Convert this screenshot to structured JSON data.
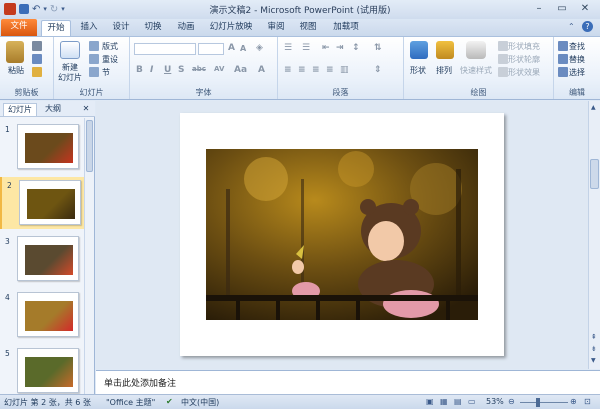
{
  "window": {
    "title": "演示文稿2 - Microsoft PowerPoint (试用版)",
    "controls": [
      "–",
      "▭",
      "✕"
    ]
  },
  "tabs": [
    "文件",
    "开始",
    "插入",
    "设计",
    "切换",
    "动画",
    "幻灯片放映",
    "审阅",
    "视图",
    "加载项"
  ],
  "ribbon": {
    "clipboard": {
      "paste": "粘贴",
      "label": "剪贴板"
    },
    "slides": {
      "new_slide": "新建",
      "new_slide2": "幻灯片",
      "layout": "版式",
      "reset": "重设",
      "section": "节",
      "label": "幻灯片"
    },
    "font": {
      "format_buttons": [
        "B",
        "I",
        "U",
        "S",
        "abc",
        "AV",
        "Aa"
      ],
      "label": "字体"
    },
    "paragraph": {
      "label": "段落"
    },
    "drawing": {
      "shape": "形状",
      "arrange": "排列",
      "quick_styles": "快速样式",
      "shape_fill": "形状填充",
      "shape_outline": "形状轮廓",
      "shape_effects": "形状效果",
      "label": "绘图"
    },
    "editing": {
      "find": "查找",
      "replace": "替换",
      "select": "选择",
      "label": "编辑"
    }
  },
  "left_pane": {
    "tabs": [
      "幻灯片",
      "大纲"
    ],
    "close": "✕",
    "slides": [
      {
        "num": "1",
        "colors": [
          "#6b4a1c",
          "#c6341f"
        ]
      },
      {
        "num": "2",
        "colors": [
          "#6e5511",
          "#3a2a10"
        ],
        "selected": true
      },
      {
        "num": "3",
        "colors": [
          "#5a4a30",
          "#d44a2a"
        ]
      },
      {
        "num": "4",
        "colors": [
          "#a57b2a",
          "#d42a2a"
        ]
      },
      {
        "num": "5",
        "colors": [
          "#5a6a2a",
          "#c86a2a"
        ]
      }
    ]
  },
  "notes": {
    "placeholder": "单击此处添加备注"
  },
  "status": {
    "slide_info": "幻灯片 第 2 张，共 6 张",
    "theme": "\"Office 主题\"",
    "language": "中文(中国)",
    "zoom": "53%"
  },
  "colors": {
    "accent": "#d9560f",
    "ribbon_border": "#9fb6d6",
    "selected": "#fde7a4"
  }
}
